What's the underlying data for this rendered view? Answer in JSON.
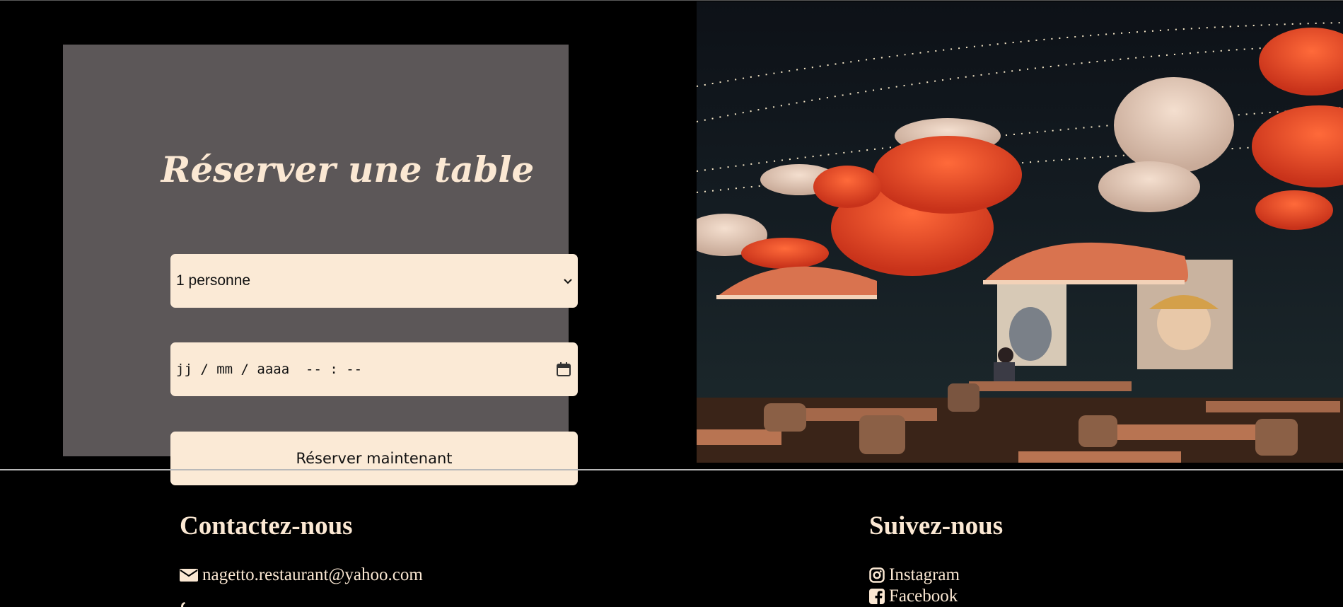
{
  "reservation": {
    "title": "Réserver une table",
    "party_size": {
      "selected": "1 personne"
    },
    "datetime": {
      "value": "jj / mm / aaaa  -- : --"
    },
    "submit_label": "Réserver maintenant"
  },
  "photo": {
    "icon": "restaurant-lanterns-photo"
  },
  "footer": {
    "contact": {
      "heading": "Contactez-nous",
      "email": "nagetto.restaurant@yahoo.com"
    },
    "follow": {
      "heading": "Suivez-nous",
      "links": [
        {
          "label": "Instagram",
          "icon": "instagram-icon"
        },
        {
          "label": "Facebook",
          "icon": "facebook-icon"
        }
      ]
    }
  },
  "colors": {
    "background": "#000000",
    "card": "#5c5758",
    "accent_cream": "#fbe8d3",
    "field": "#fbead6"
  }
}
